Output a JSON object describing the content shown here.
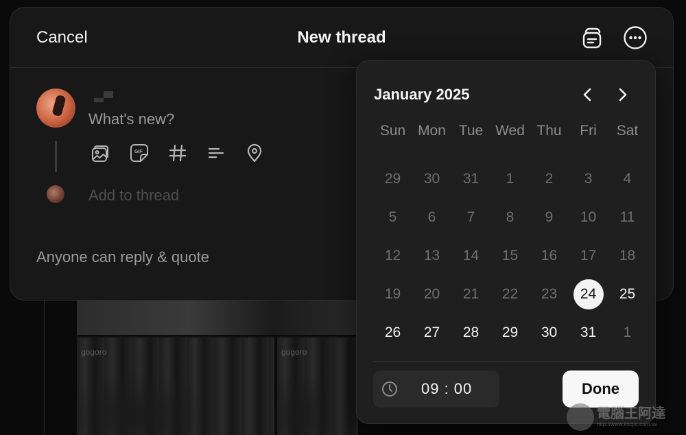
{
  "header": {
    "cancel_label": "Cancel",
    "title": "New thread",
    "drafts_icon": "drafts-icon",
    "more_icon": "more-options-icon"
  },
  "composer": {
    "prompt": "What's new?",
    "tools": [
      "image-icon",
      "gif-icon",
      "hashtag-icon",
      "poll-icon",
      "location-icon"
    ],
    "add_to_thread": "Add to thread",
    "reply_setting": "Anyone can reply & quote"
  },
  "date_picker": {
    "month_title": "January 2025",
    "weekdays": [
      "Sun",
      "Mon",
      "Tue",
      "Wed",
      "Thu",
      "Fri",
      "Sat"
    ],
    "days": [
      {
        "label": "29",
        "active": false
      },
      {
        "label": "30",
        "active": false
      },
      {
        "label": "31",
        "active": false
      },
      {
        "label": "1",
        "active": false
      },
      {
        "label": "2",
        "active": false
      },
      {
        "label": "3",
        "active": false
      },
      {
        "label": "4",
        "active": false
      },
      {
        "label": "5",
        "active": false
      },
      {
        "label": "6",
        "active": false
      },
      {
        "label": "7",
        "active": false
      },
      {
        "label": "8",
        "active": false
      },
      {
        "label": "9",
        "active": false
      },
      {
        "label": "10",
        "active": false
      },
      {
        "label": "11",
        "active": false
      },
      {
        "label": "12",
        "active": false
      },
      {
        "label": "13",
        "active": false
      },
      {
        "label": "14",
        "active": false
      },
      {
        "label": "15",
        "active": false
      },
      {
        "label": "16",
        "active": false
      },
      {
        "label": "17",
        "active": false
      },
      {
        "label": "18",
        "active": false
      },
      {
        "label": "19",
        "active": false
      },
      {
        "label": "20",
        "active": false
      },
      {
        "label": "21",
        "active": false
      },
      {
        "label": "22",
        "active": false
      },
      {
        "label": "23",
        "active": false
      },
      {
        "label": "24",
        "active": true,
        "selected": true
      },
      {
        "label": "25",
        "active": true
      },
      {
        "label": "26",
        "active": true
      },
      {
        "label": "27",
        "active": true
      },
      {
        "label": "28",
        "active": true
      },
      {
        "label": "29",
        "active": true
      },
      {
        "label": "30",
        "active": true
      },
      {
        "label": "31",
        "active": true
      },
      {
        "label": "1",
        "active": false
      }
    ],
    "time": "09 : 00",
    "done_label": "Done",
    "prev_icon": "chevron-left-icon",
    "next_icon": "chevron-right-icon",
    "clock_icon": "clock-icon"
  },
  "background": {
    "brand_text_1": "gogoro",
    "brand_text_2": "gogoro"
  },
  "watermark": {
    "text": "電腦王阿達",
    "url": "http://www.kocpc.com.tw"
  },
  "colors": {
    "sheet_bg": "#181818",
    "picker_bg": "#1f1f1f",
    "text_primary": "#f3f3f3",
    "text_muted": "#9a9a9a",
    "selected_day_bg": "#f3f3f3"
  }
}
